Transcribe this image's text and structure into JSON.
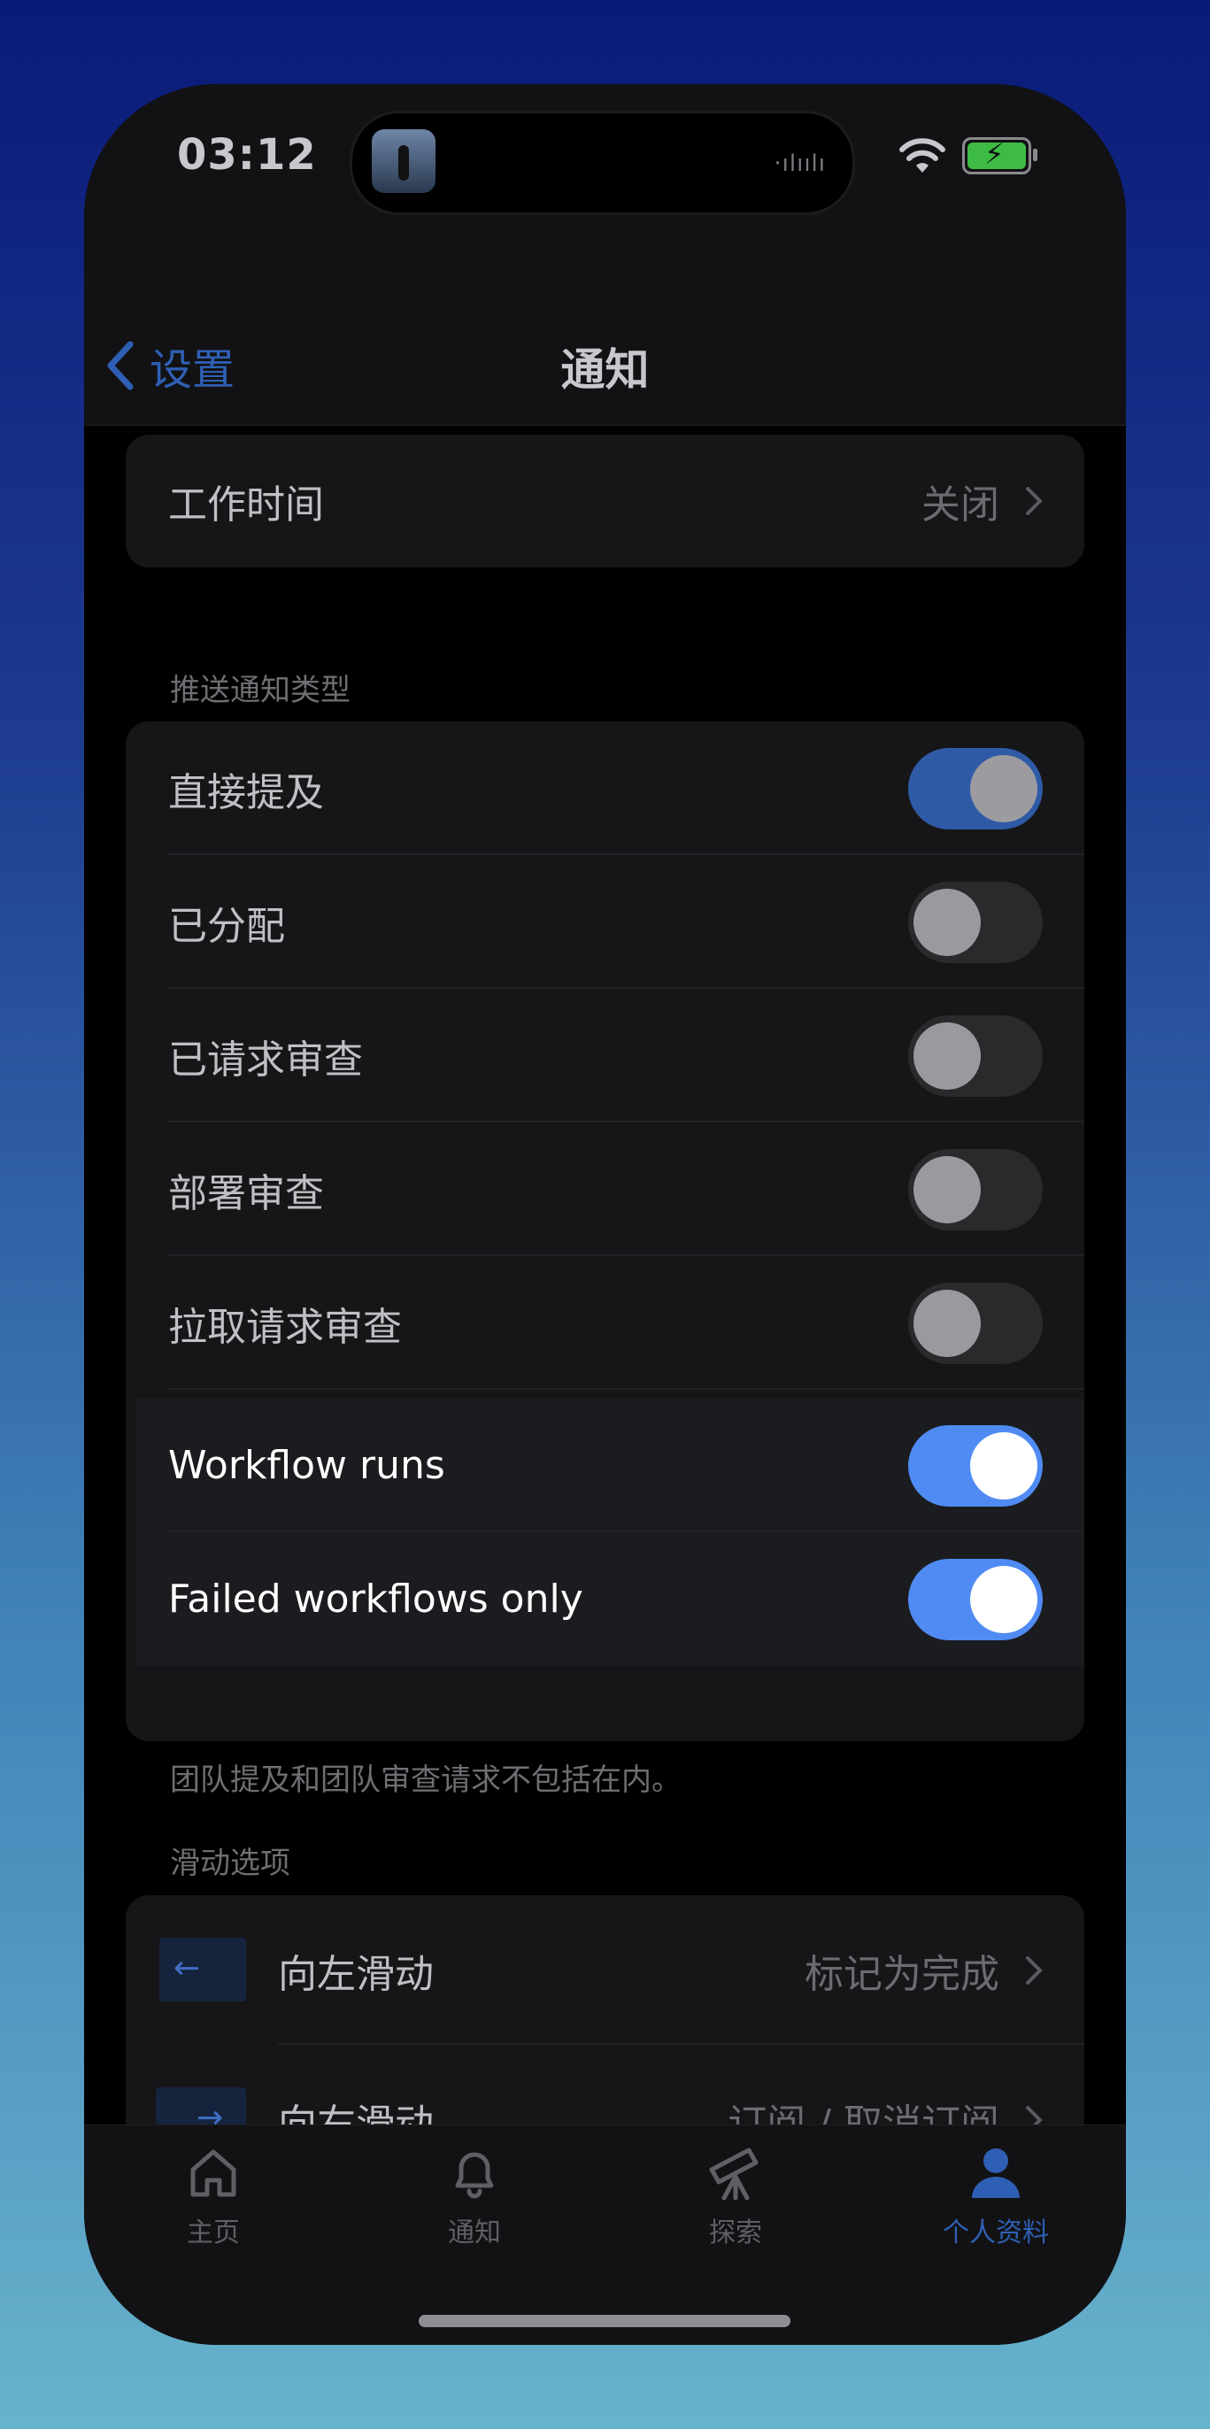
{
  "status_bar": {
    "time": "03:12"
  },
  "nav": {
    "back_label": "设置",
    "title": "通知"
  },
  "work_hours": {
    "label": "工作时间",
    "value": "关闭"
  },
  "push_section": {
    "header": "推送通知类型",
    "items": [
      {
        "label": "直接提及",
        "state": "on"
      },
      {
        "label": "已分配",
        "state": "off"
      },
      {
        "label": "已请求审查",
        "state": "off"
      },
      {
        "label": "部署审查",
        "state": "off"
      },
      {
        "label": "拉取请求审查",
        "state": "off"
      },
      {
        "label": "Workflow runs",
        "state": "on"
      },
      {
        "label": "Failed workflows only",
        "state": "on"
      }
    ],
    "footer": "团队提及和团队审查请求不包括在内。"
  },
  "swipe_section": {
    "header": "滑动选项",
    "items": [
      {
        "label": "向左滑动",
        "value": "标记为完成",
        "icon": "arrow-left-icon"
      },
      {
        "label": "向右滑动",
        "value": "订阅 / 取消订阅",
        "icon": "arrow-right-icon"
      }
    ]
  },
  "tabbar": {
    "tabs": [
      {
        "label": "主页",
        "icon": "home-icon"
      },
      {
        "label": "通知",
        "icon": "bell-icon"
      },
      {
        "label": "探索",
        "icon": "telescope-icon"
      },
      {
        "label": "个人资料",
        "icon": "person-icon",
        "active": true
      }
    ]
  },
  "colors": {
    "accent": "#4f8bf3",
    "accent_dim": "#2f5aa6",
    "background": "#000000",
    "card": "#161618"
  }
}
